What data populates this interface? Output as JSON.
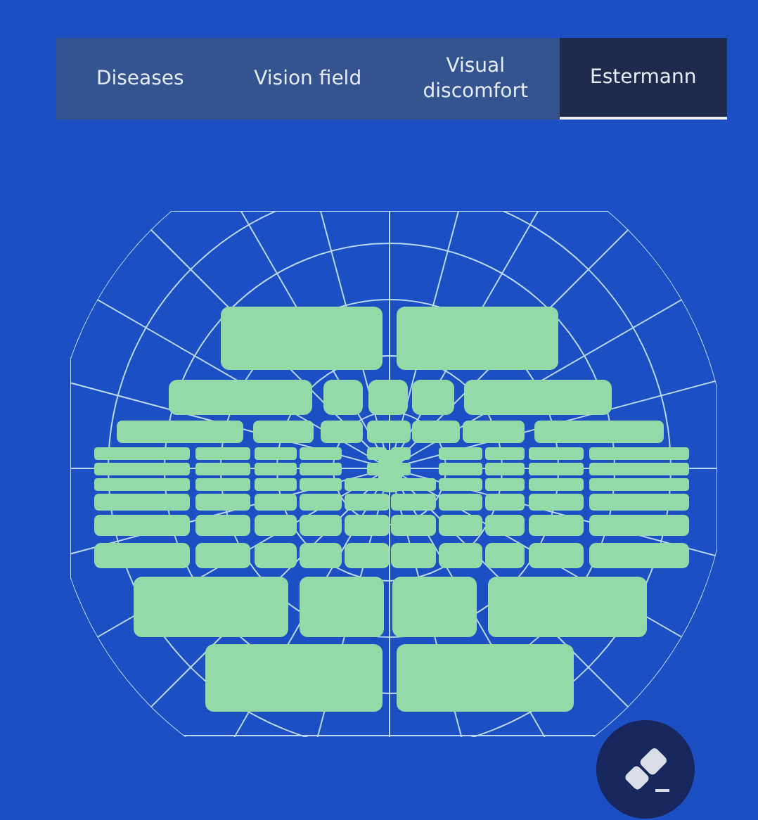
{
  "tabs": [
    {
      "label": "Diseases",
      "selected": false
    },
    {
      "label": "Vision field",
      "selected": false
    },
    {
      "label": "Visual discomfort",
      "selected": false
    },
    {
      "label": "Estermann",
      "selected": true
    }
  ]
}
